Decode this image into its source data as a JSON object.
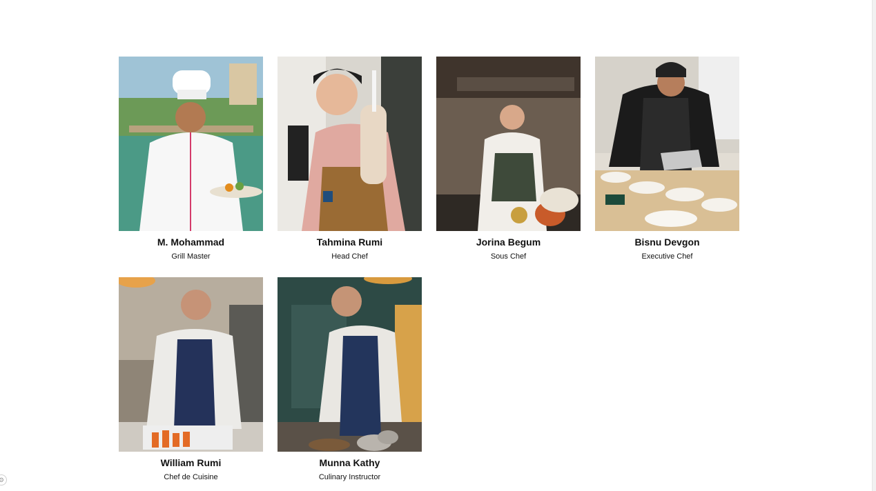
{
  "team": [
    {
      "name": "M. Mohammad",
      "role": "Grill Master",
      "photo": "chef-photo-white-uniform-outdoor"
    },
    {
      "name": "Tahmina Rumi",
      "role": "Head Chef",
      "photo": "chef-photo-apron-holding-drink"
    },
    {
      "name": "Jorina Begum",
      "role": "Sous Chef",
      "photo": "chef-photo-kitchen-counter"
    },
    {
      "name": "Bisnu Devgon",
      "role": "Executive Chef",
      "photo": "chef-photo-plating-dishes"
    },
    {
      "name": "William Rumi",
      "role": "Chef de Cuisine",
      "photo": "chef-photo-cutting-carrots"
    },
    {
      "name": "Munna Kathy",
      "role": "Culinary Instructor",
      "photo": "chef-photo-preparing-food"
    }
  ]
}
